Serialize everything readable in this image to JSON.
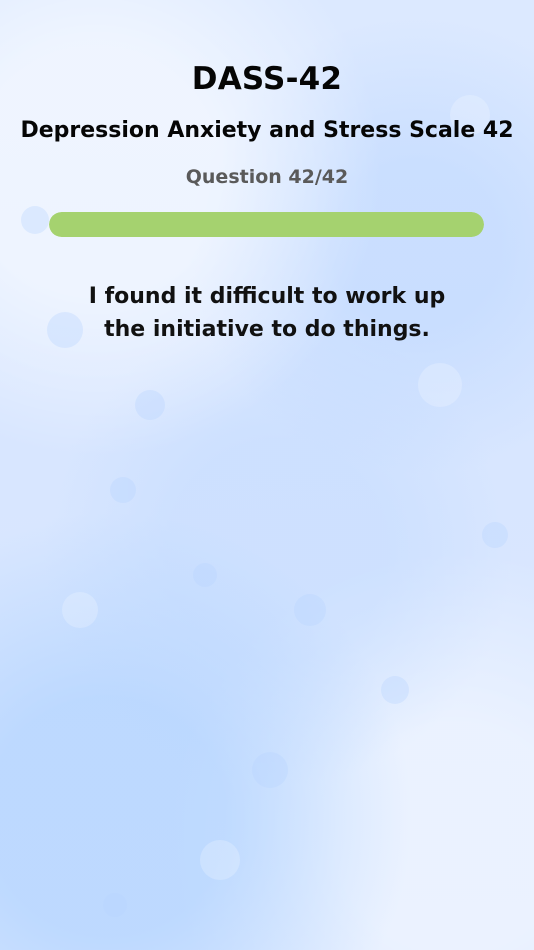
{
  "header": {
    "title": "DASS-42",
    "subtitle": "Depression Anxiety and Stress Scale 42"
  },
  "progress": {
    "label": "Question 42/42",
    "current": 42,
    "total": 42,
    "fraction": 1.0,
    "color": "#a5d26f"
  },
  "question": {
    "text": "I found it difficult to work up the initiative to do things."
  },
  "background": {
    "base_color": "#d9e8ff"
  }
}
